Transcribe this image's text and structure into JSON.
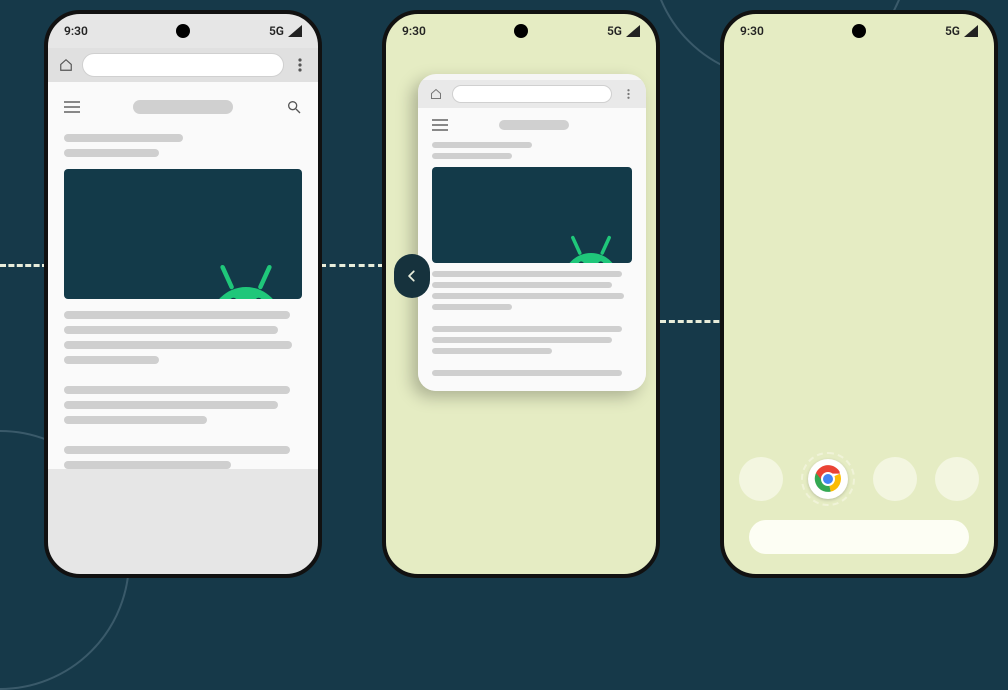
{
  "status": {
    "time": "9:30",
    "network": "5G"
  },
  "icons": {
    "home": "home-icon",
    "more": "more-icon",
    "hamburger": "hamburger-icon",
    "search": "search-icon",
    "back": "back-chevron-icon",
    "signal": "signal-icon",
    "chrome": "chrome-icon",
    "android": "android-robot"
  },
  "colors": {
    "background": "#163949",
    "phone_wallpaper": "#e5ecc3",
    "hero": "#133a49",
    "android_green": "#1fc77a",
    "dashed": "#e8eddb"
  },
  "phones": {
    "browser": {
      "state": "fullscreen-web-article"
    },
    "overview": {
      "state": "recents-card-preview"
    },
    "home": {
      "state": "home-screen",
      "focused_app": "chrome"
    }
  }
}
